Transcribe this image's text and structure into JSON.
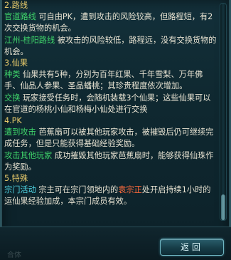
{
  "content": {
    "s2_title": "2.路线",
    "s2_route1_name": "官道路线",
    "s2_route1_text": " 可自由PK，遭到攻击的风险较高，但路程短，有2次交换货物的机会。",
    "s2_route2_name": "江州-桂阳路线",
    "s2_route2_text": " 被攻击的风险较低，路程远，没有交换货物的机会。",
    "s3_title": "3.仙果",
    "s3_kinds_name": "种类",
    "s3_kinds_text": " 仙果共有5种，分别为百年红果、千年雪梨、万年佛手、仙品人参果、圣品蟠桃；其珍贵程度依次增加。",
    "s3_exchange_name": "交换",
    "s3_exchange_text": " 玩家接受任务时，会随机装载3个仙果；这些仙果可以在官道的杨桃小仙和杨梅小仙处进行交换",
    "s4_title": "4.PK",
    "s4_attacked_name": "遭到攻击",
    "s4_attacked_text": " 芭蕉扇可以被其他玩家攻击，被摧毁后仍可继续完成任务，但是只能获得基础经验奖励。",
    "s4_attack_name": "攻击其他玩家",
    "s4_attack_text": " 成功摧毁其他玩家芭蕉扇时，能够获得仙珠作为奖励。",
    "s5_title": "5.特殊",
    "s5_sect_name": "宗门活动",
    "s5_sect_text_a": " 宗主可在宗门领地内的",
    "s5_sect_highlight": "袁宗正",
    "s5_sect_text_b": "处开启持续1小时的运仙果经验加成，本宗门成员有效。"
  },
  "footer": {
    "ghost_text": "合体",
    "return_label": "返回"
  },
  "colors": {
    "section_title": "#e6c96a",
    "keyword_green": "#3fd46a",
    "keyword_cyan": "#4fd2e0",
    "npc_red": "#ff6a3c",
    "body_text": "#e9e4d3"
  }
}
